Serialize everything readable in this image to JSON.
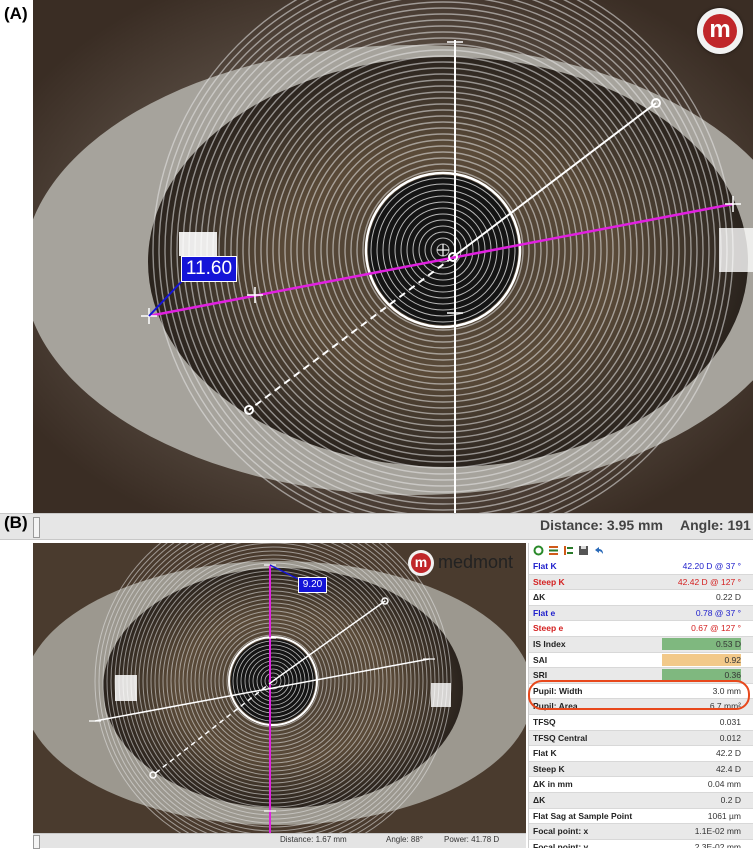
{
  "panel_labels": {
    "a": "(A)",
    "b": "(B)"
  },
  "panel_a": {
    "logo_letter": "m",
    "measurement_label": "11.60",
    "status": {
      "distance": "Distance:  3.95 mm",
      "angle": "Angle:  191"
    }
  },
  "panel_b": {
    "logo_letter": "m",
    "brand": "medmont",
    "measurement_label": "9.20",
    "status": {
      "distance": "Distance: 1.67 mm",
      "angle": "Angle:  88°",
      "power": "Power:   41.78 D"
    }
  },
  "table": {
    "toolbar_icons": [
      "refresh-icon",
      "list-icon",
      "list-alt-icon",
      "save-icon",
      "undo-icon"
    ],
    "rows": [
      {
        "label": "Flat K",
        "value": "42.20 D @  37 °",
        "color": "blue"
      },
      {
        "label": "Steep K",
        "value": "42.42 D @ 127 °",
        "color": "red"
      },
      {
        "label": "ΔK",
        "value": "0.22 D",
        "color": "dark"
      },
      {
        "label": "Flat e",
        "value": "0.78 @  37 °",
        "color": "blue"
      },
      {
        "label": "Steep e",
        "value": "0.67 @ 127 °",
        "color": "red"
      },
      {
        "label": "IS Index",
        "value": "0.53 D",
        "color": "dark",
        "bar": "#7fb87f"
      },
      {
        "label": "SAI",
        "value": "0.92",
        "color": "dark",
        "bar": "#f2c98a"
      },
      {
        "label": "SRI",
        "value": "0.36",
        "color": "dark",
        "bar": "#7fb87f"
      },
      {
        "label": "Pupil: Width",
        "value": "3.0 mm",
        "color": "dark"
      },
      {
        "label": "Pupil: Area",
        "value": "6.7 mm²",
        "color": "dark"
      },
      {
        "label": "TFSQ",
        "value": "0.031",
        "color": "dark"
      },
      {
        "label": "TFSQ Central",
        "value": "0.012",
        "color": "dark"
      },
      {
        "label": "Flat K",
        "value": "42.2 D",
        "color": "dark"
      },
      {
        "label": "Steep K",
        "value": "42.4 D",
        "color": "dark"
      },
      {
        "label": "ΔK in mm",
        "value": "0.04 mm",
        "color": "dark"
      },
      {
        "label": "ΔK",
        "value": "0.2 D",
        "color": "dark"
      },
      {
        "label": "Flat Sag at Sample Point",
        "value": "1061 µm",
        "color": "dark"
      },
      {
        "label": "Focal point: x",
        "value": "1.1E-02 mm",
        "color": "dark"
      },
      {
        "label": "Focal point: y",
        "value": "2.3E-02 mm",
        "color": "dark"
      }
    ]
  },
  "colors": {
    "highlight": "#e8481c",
    "measure_blue": "#1414d8",
    "axis_magenta": "#e020e0"
  }
}
